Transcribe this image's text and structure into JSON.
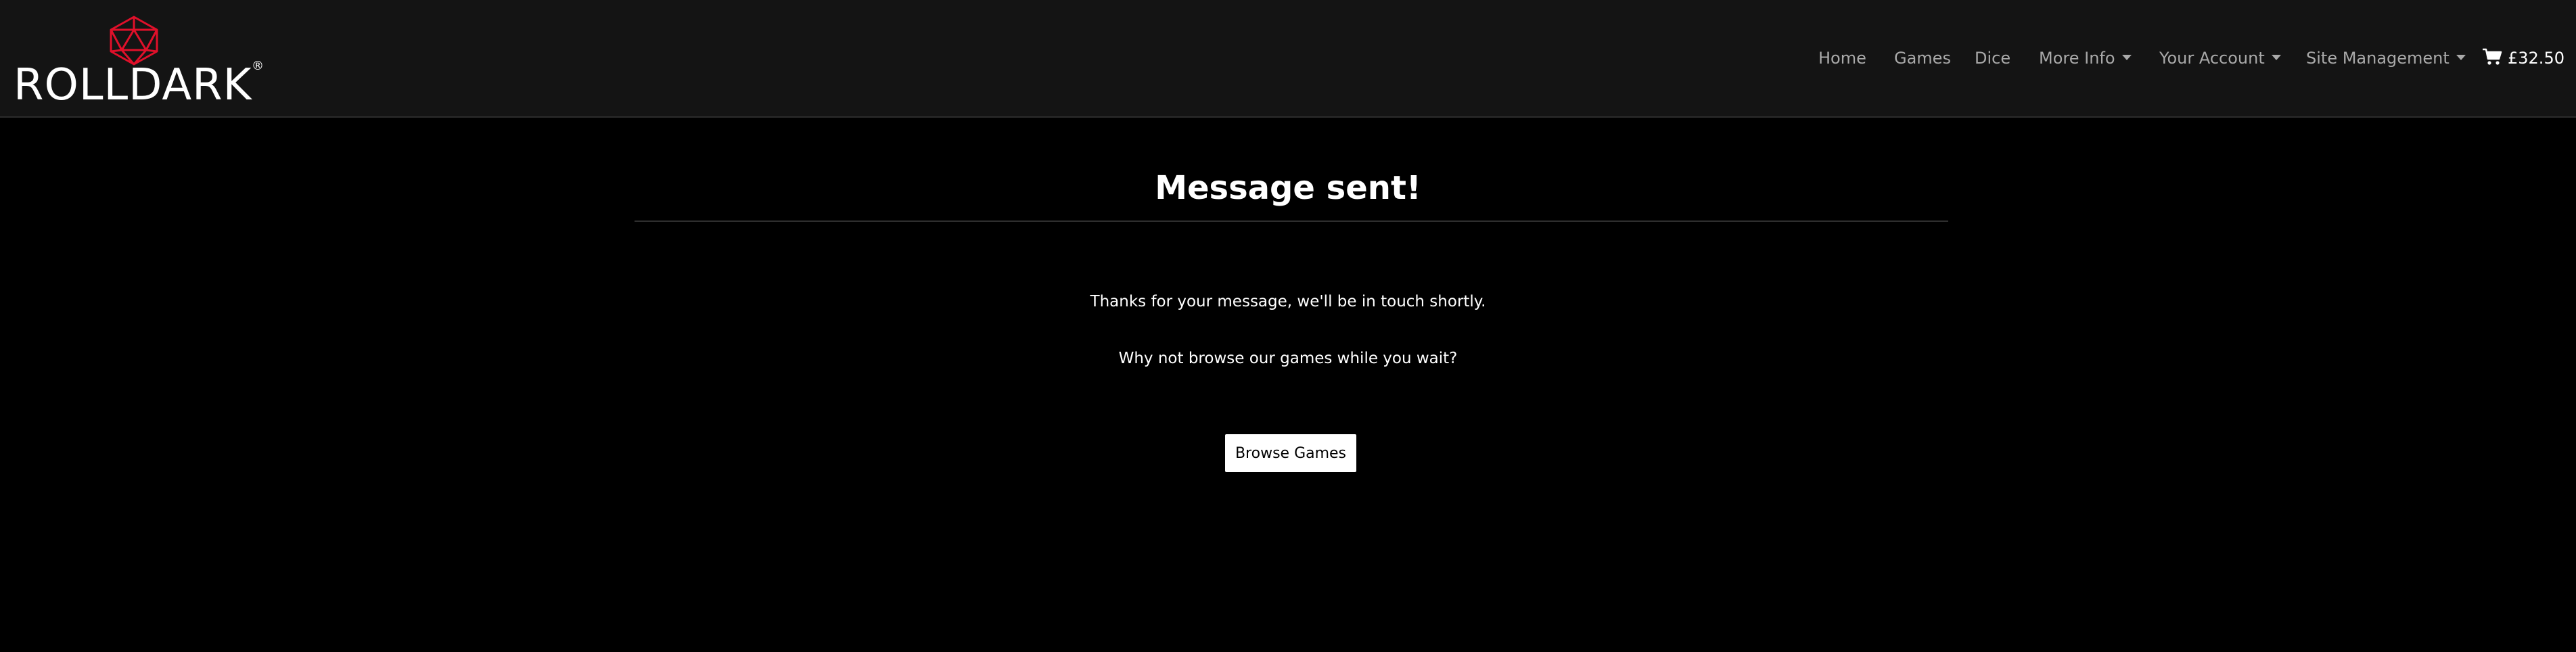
{
  "header": {
    "brand_name": "ROLLDARK",
    "brand_registered": "®",
    "logo_icon": "d20-die-icon",
    "accent_color": "#e0102a",
    "nav": {
      "home": "Home",
      "games": "Games",
      "dice": "Dice",
      "more_info": "More Info",
      "your_account": "Your Account",
      "site_management": "Site Management",
      "cart_total": "£32.50",
      "cart_icon": "shopping-cart-icon"
    }
  },
  "main": {
    "title": "Message sent!",
    "thanks_text": "Thanks for your message, we'll be in touch shortly.",
    "browse_prompt": "Why not browse our games while you wait?",
    "browse_button": "Browse Games"
  }
}
